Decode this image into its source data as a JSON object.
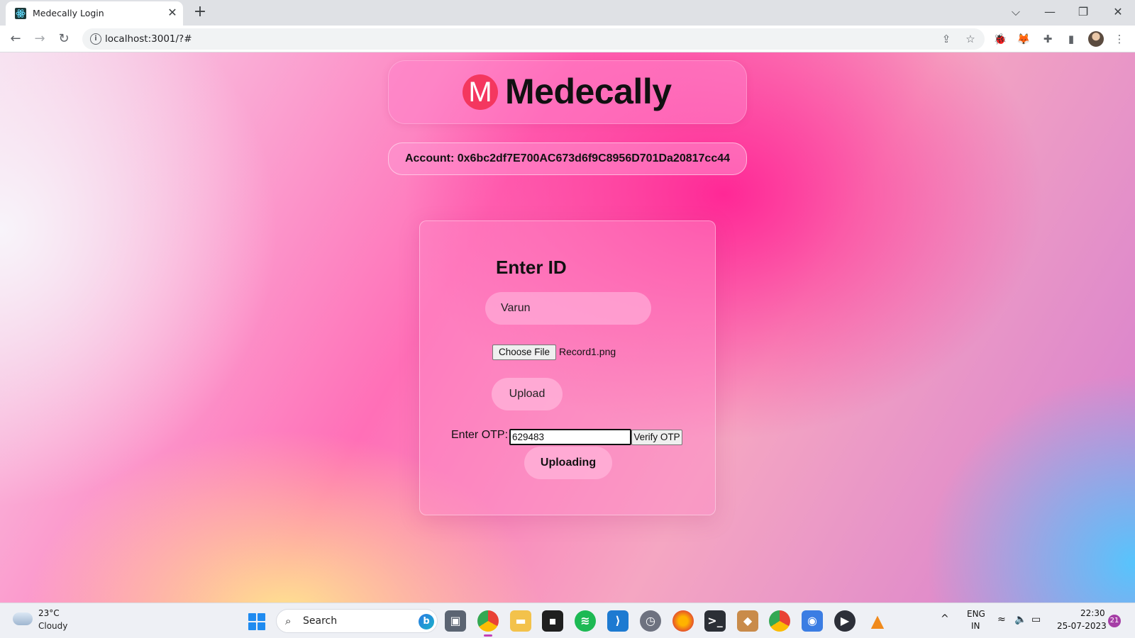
{
  "browser": {
    "tab_title": "Medecally Login",
    "tab_close": "✕",
    "new_tab": "+",
    "url": "localhost:3001/?#",
    "window_controls": {
      "dropdown": "⌵",
      "minimize": "—",
      "restore": "❐",
      "close": "✕"
    }
  },
  "app": {
    "logo_letter": "M",
    "logo_name": "Medecally",
    "logo_color": "#f4375f",
    "account_text": "Account: 0x6bc2df7E700AC673d6f9C8956D701Da20817cc44"
  },
  "form": {
    "title": "Enter ID",
    "id_value": "Varun",
    "choose_file_label": "Choose File",
    "file_name": "Record1.png",
    "upload_label": "Upload",
    "otp_label": "Enter OTP:",
    "otp_value": "629483",
    "verify_label": "Verify OTP",
    "status_label": "Uploading"
  },
  "taskbar": {
    "weather_temp": "23°C",
    "weather_condition": "Cloudy",
    "search_placeholder": "Search",
    "language_line1": "ENG",
    "language_line2": "IN",
    "time": "22:30",
    "date": "25-07-2023",
    "notification_count": "21"
  }
}
